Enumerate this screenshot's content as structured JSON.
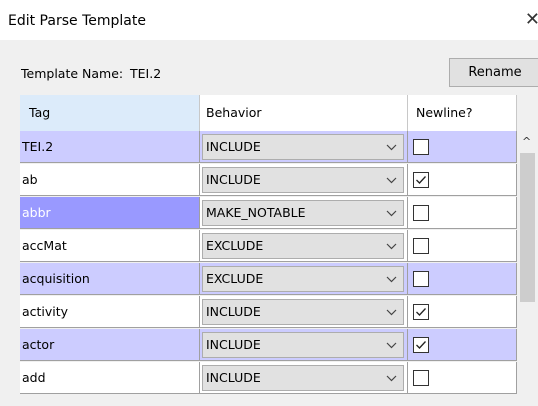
{
  "window": {
    "title": "Edit Parse Template",
    "close_glyph": "✕"
  },
  "template_name": {
    "label": "Template Name:",
    "value": "TEI.2"
  },
  "rename_button": "Rename",
  "columns": {
    "tag": "Tag",
    "behavior": "Behavior",
    "newline": "Newline?"
  },
  "rows": [
    {
      "tag": "TEI.2",
      "behavior": "INCLUDE",
      "newline": false,
      "row_color": "#ccccff",
      "tag_color": "#ccccff",
      "tag_text_color": "#000000"
    },
    {
      "tag": "ab",
      "behavior": "INCLUDE",
      "newline": true,
      "row_color": "#ffffff",
      "tag_color": "#ffffff",
      "tag_text_color": "#000000"
    },
    {
      "tag": "abbr",
      "behavior": "MAKE_NOTABLE",
      "newline": false,
      "row_color": "#ffffff",
      "tag_color": "#9999ff",
      "tag_text_color": "#ffffff"
    },
    {
      "tag": "accMat",
      "behavior": "EXCLUDE",
      "newline": false,
      "row_color": "#ffffff",
      "tag_color": "#ffffff",
      "tag_text_color": "#000000"
    },
    {
      "tag": "acquisition",
      "behavior": "EXCLUDE",
      "newline": false,
      "row_color": "#ccccff",
      "tag_color": "#ccccff",
      "tag_text_color": "#000000"
    },
    {
      "tag": "activity",
      "behavior": "INCLUDE",
      "newline": true,
      "row_color": "#ffffff",
      "tag_color": "#ffffff",
      "tag_text_color": "#000000"
    },
    {
      "tag": "actor",
      "behavior": "INCLUDE",
      "newline": true,
      "row_color": "#ccccff",
      "tag_color": "#ccccff",
      "tag_text_color": "#000000"
    },
    {
      "tag": "add",
      "behavior": "INCLUDE",
      "newline": false,
      "row_color": "#ffffff",
      "tag_color": "#ffffff",
      "tag_text_color": "#000000"
    }
  ],
  "icons": {
    "dropdown": "chevron-down-icon",
    "scroll_up": "scroll-up-arrow-icon",
    "check": "check-icon"
  }
}
